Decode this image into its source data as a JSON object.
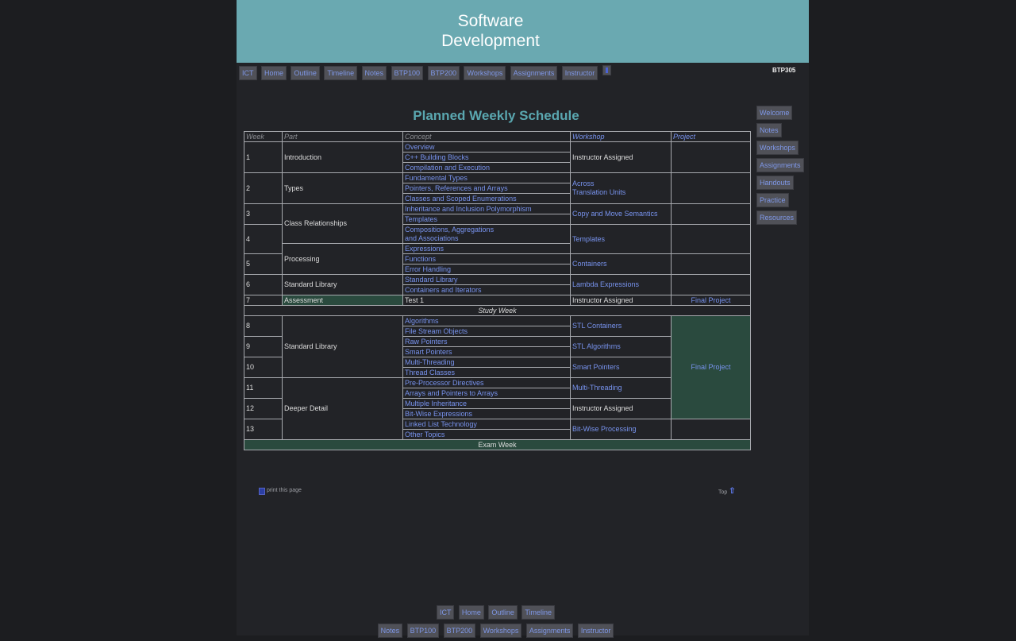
{
  "banner": {
    "line1": "Software",
    "line2": "Development"
  },
  "course_code": "BTP305",
  "top_nav": [
    "ICT",
    "Home",
    "Outline",
    "Timeline",
    "Notes",
    "BTP100",
    "BTP200",
    "Workshops",
    "Assignments",
    "Instructor"
  ],
  "side_nav": [
    "Welcome",
    "Notes",
    "Workshops",
    "Assignments",
    "Handouts",
    "Practice",
    "Resources"
  ],
  "title": "Planned Weekly Schedule",
  "table": {
    "headers": {
      "week": "Week",
      "part": "Part",
      "concept": "Concept",
      "workshop": "Workshop",
      "project": "Project"
    },
    "weeks": [
      "1",
      "2",
      "3",
      "4",
      "5",
      "6",
      "7",
      "8",
      "9",
      "10",
      "11",
      "12",
      "13"
    ],
    "parts": {
      "introduction": "Introduction",
      "types": "Types",
      "class_relationships": "Class Relationships",
      "processing": "Processing",
      "standard_library": "Standard Library",
      "assessment": "Assessment",
      "standard_library_2": "Standard Library",
      "deeper_detail": "Deeper Detail"
    },
    "concepts": [
      "Overview",
      "C++ Building Blocks",
      "Compilation and Execution",
      "Fundamental Types",
      "Pointers, References and Arrays",
      "Classes and Scoped Enumerations",
      "Inheritance and Inclusion Polymorphism",
      "Templates",
      "Compositions, Aggregations",
      "and Associations",
      "Expressions",
      "Functions",
      "Error Handling",
      "Standard Library",
      "Containers and Iterators",
      "Test 1",
      "Algorithms",
      "File Stream Objects",
      "Raw Pointers",
      "Smart Pointers",
      "Multi-Threading",
      "Thread Classes",
      "Pre-Processor Directives",
      "Arrays and Pointers to Arrays",
      "Multiple Inheritance",
      "Bit-Wise Expressions",
      "Linked List Technology",
      "Other Topics"
    ],
    "workshops": {
      "w1": "Instructor Assigned",
      "w2a": "Across",
      "w2b": "Translation Units",
      "w3": "Copy and Move Semantics",
      "w4": "Templates",
      "w5": "Containers",
      "w6": "Lambda Expressions",
      "w7": "Instructor Assigned",
      "w8": "STL Containers",
      "w9": "STL Algorithms",
      "w10": "Smart Pointers",
      "w11": "Multi-Threading",
      "w12": "Instructor Assigned",
      "w13": "Bit-Wise Processing"
    },
    "projects": {
      "p7": "Final Project",
      "p8_12": "Final Project"
    },
    "study_week": "Study Week",
    "exam_week": "Exam Week"
  },
  "footer": {
    "print": "print this page",
    "top": "Top"
  },
  "bottom_nav": {
    "row1": [
      "ICT",
      "Home",
      "Outline",
      "Timeline"
    ],
    "row2": [
      "Notes",
      "BTP100",
      "BTP200",
      "Workshops",
      "Assignments",
      "Instructor"
    ]
  },
  "colors": {
    "banner": "#6aa9b1",
    "title": "#5aa7b0",
    "link": "#7893ee",
    "highlight": "#2a4a3e",
    "background": "#222327"
  }
}
